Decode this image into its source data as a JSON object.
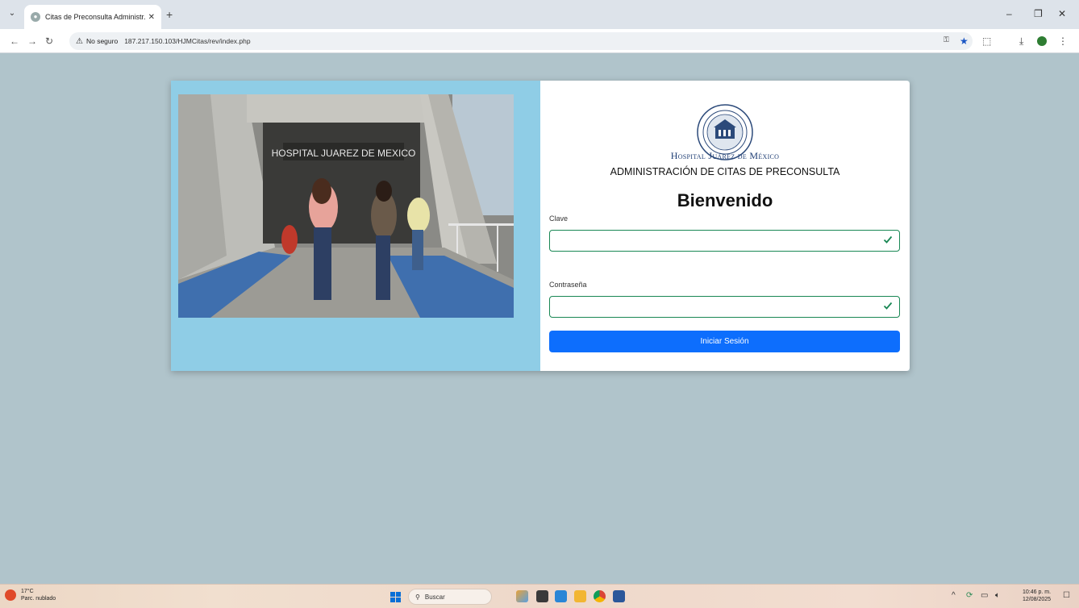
{
  "browser": {
    "tab_title": "Citas de Preconsulta Administr...",
    "new_tab": "+",
    "close_tab": "✕",
    "address": {
      "warning_icon": "⚠",
      "security_label": "No seguro",
      "url": "187.217.150.103/HJMCitas/rev/index.php"
    }
  },
  "login": {
    "hospital_name": "Hospital Juárez de México",
    "subtitle": "ADMINISTRACIÓN DE CITAS DE PRECONSULTA",
    "welcome": "Bienvenido",
    "clave_label": "Clave",
    "password_label": "Contraseña",
    "button_label": "Iniciar Sesión",
    "photo_sign_text": "HOSPITAL JUAREZ DE MEXICO"
  },
  "taskbar": {
    "temperature": "17°C",
    "weather": "Parc. nublado",
    "search_placeholder": "Buscar",
    "time": "10:46 p. m.",
    "date": "12/08/2025"
  },
  "colors": {
    "page_bg": "#b0c4cb",
    "left_panel": "#8fcde6",
    "primary_button": "#0d6efd",
    "valid_border": "#198754",
    "hospital_text": "#1f3e74"
  }
}
